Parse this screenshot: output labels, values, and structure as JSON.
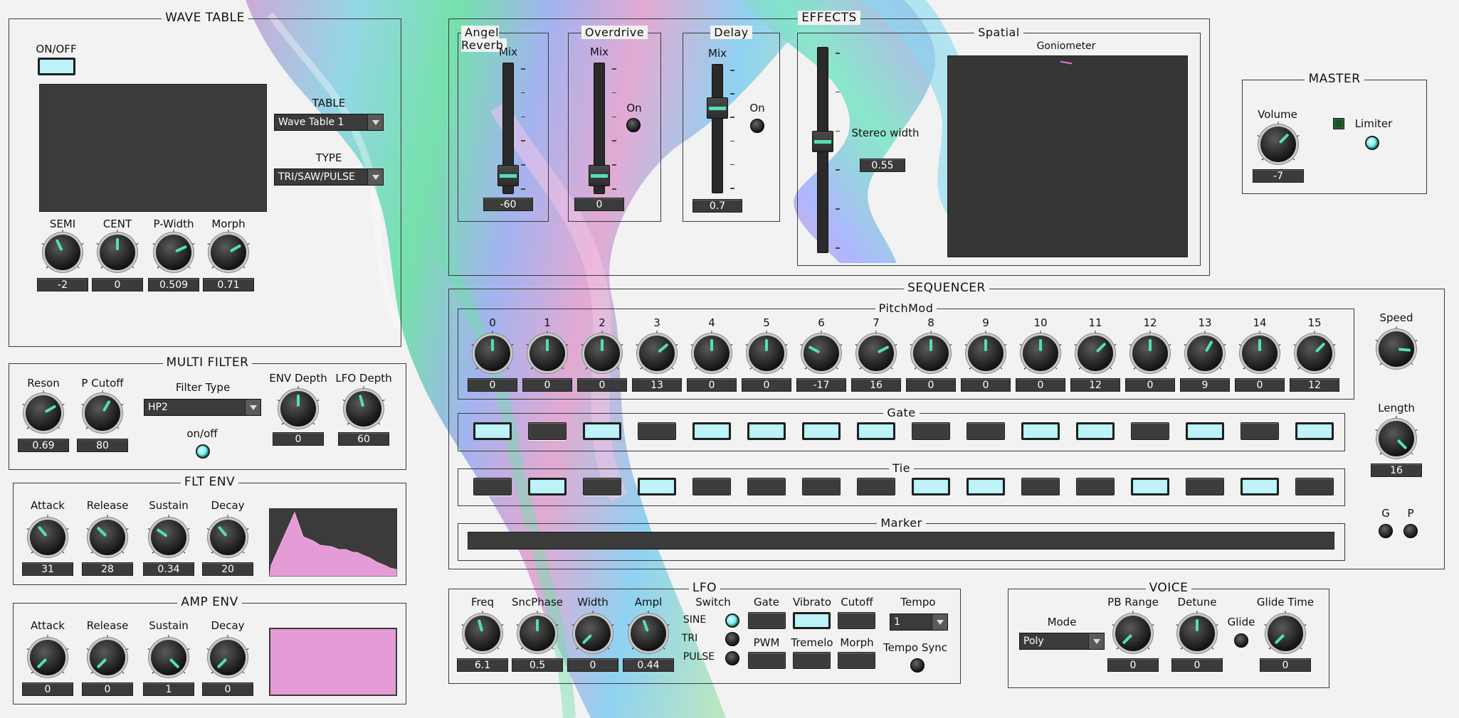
{
  "wavetable": {
    "title": "WAVE TABLE",
    "onoff_label": "ON/OFF",
    "table_label": "TABLE",
    "table_value": "Wave Table 1",
    "type_label": "TYPE",
    "type_value": "TRI/SAW/PULSE",
    "knobs": [
      {
        "label": "SEMI",
        "value": "-2",
        "angle": -25
      },
      {
        "label": "CENT",
        "value": "0",
        "angle": 0
      },
      {
        "label": "P-Width",
        "value": "0.509",
        "angle": 65
      },
      {
        "label": "Morph",
        "value": "0.71",
        "angle": 60
      }
    ]
  },
  "multifilter": {
    "title": "MULTI FILTER",
    "filter_type_label": "Filter Type",
    "filter_type_value": "HP2",
    "onoff_label": "on/off",
    "knobs": [
      {
        "label": "Reson",
        "value": "0.69",
        "angle": 60
      },
      {
        "label": "P Cutoff",
        "value": "80",
        "angle": 30
      },
      {
        "label": "ENV Depth",
        "value": "0",
        "angle": 0
      },
      {
        "label": "LFO Depth",
        "value": "60",
        "angle": -15
      }
    ]
  },
  "fltenv": {
    "title": "FLT ENV",
    "knobs": [
      {
        "label": "Attack",
        "value": "31",
        "angle": -40
      },
      {
        "label": "Release",
        "value": "28",
        "angle": -45
      },
      {
        "label": "Sustain",
        "value": "0.34",
        "angle": -55
      },
      {
        "label": "Decay",
        "value": "20",
        "angle": -40
      }
    ]
  },
  "ampenv": {
    "title": "AMP ENV",
    "knobs": [
      {
        "label": "Attack",
        "value": "0",
        "angle": -135
      },
      {
        "label": "Release",
        "value": "0",
        "angle": -135
      },
      {
        "label": "Sustain",
        "value": "1",
        "angle": 135
      },
      {
        "label": "Decay",
        "value": "0",
        "angle": -135
      }
    ]
  },
  "effects": {
    "title": "EFFECTS",
    "reverb": {
      "title": "Angel Reverb",
      "mix_label": "Mix",
      "value": "-60",
      "level": 0.08
    },
    "overdrive": {
      "title": "Overdrive",
      "mix_label": "Mix",
      "value": "0",
      "on_label": "On",
      "level": 0.08
    },
    "delay": {
      "title": "Delay",
      "mix_label": "Mix",
      "value": "0.7",
      "on_label": "On",
      "level": 0.7
    },
    "spatial": {
      "title": "Spatial",
      "stereo_label": "Stereo width",
      "stereo_value": "0.55",
      "goniometer_label": "Goniometer",
      "level": 0.55
    }
  },
  "master": {
    "title": "MASTER",
    "volume_label": "Volume",
    "volume_value": "-7",
    "volume_angle": 45,
    "limiter_label": "Limiter"
  },
  "sequencer": {
    "title": "SEQUENCER",
    "pitchmod_label": "PitchMod",
    "gate_label": "Gate",
    "tie_label": "Tie",
    "marker_label": "Marker",
    "speed_label": "Speed",
    "speed_angle": 95,
    "length_label": "Length",
    "length_value": "16",
    "length_angle": 135,
    "g_label": "G",
    "p_label": "P",
    "steps": [
      {
        "n": "0",
        "value": "0",
        "angle": 0,
        "gate": true,
        "tie": false
      },
      {
        "n": "1",
        "value": "0",
        "angle": 0,
        "gate": false,
        "tie": true
      },
      {
        "n": "2",
        "value": "0",
        "angle": 0,
        "gate": true,
        "tie": false
      },
      {
        "n": "3",
        "value": "13",
        "angle": 50,
        "gate": false,
        "tie": true
      },
      {
        "n": "4",
        "value": "0",
        "angle": 0,
        "gate": true,
        "tie": false
      },
      {
        "n": "5",
        "value": "0",
        "angle": 0,
        "gate": true,
        "tie": false
      },
      {
        "n": "6",
        "value": "-17",
        "angle": -62,
        "gate": true,
        "tie": false
      },
      {
        "n": "7",
        "value": "16",
        "angle": 62,
        "gate": true,
        "tie": false
      },
      {
        "n": "8",
        "value": "0",
        "angle": 0,
        "gate": false,
        "tie": true
      },
      {
        "n": "9",
        "value": "0",
        "angle": 0,
        "gate": false,
        "tie": true
      },
      {
        "n": "10",
        "value": "0",
        "angle": 0,
        "gate": true,
        "tie": false
      },
      {
        "n": "11",
        "value": "12",
        "angle": 45,
        "gate": true,
        "tie": false
      },
      {
        "n": "12",
        "value": "0",
        "angle": 0,
        "gate": false,
        "tie": true
      },
      {
        "n": "13",
        "value": "9",
        "angle": 30,
        "gate": true,
        "tie": false
      },
      {
        "n": "14",
        "value": "0",
        "angle": 0,
        "gate": false,
        "tie": true
      },
      {
        "n": "15",
        "value": "12",
        "angle": 45,
        "gate": true,
        "tie": false
      }
    ]
  },
  "lfo": {
    "title": "LFO",
    "switch_label": "Switch",
    "sine_label": "SINE",
    "tri_label": "TRI",
    "pulse_label": "PULSE",
    "gate_label": "Gate",
    "vibrato_label": "Vibrato",
    "cutoff_label": "Cutoff",
    "pwm_label": "PWM",
    "tremelo_label": "Tremelo",
    "morph_label": "Morph",
    "tempo_label": "Tempo",
    "tempo_value": "1",
    "tempo_sync_label": "Tempo Sync",
    "knobs": [
      {
        "label": "Freq",
        "value": "6.1",
        "angle": -15
      },
      {
        "label": "SncPhase",
        "value": "0.5",
        "angle": 0
      },
      {
        "label": "Width",
        "value": "0",
        "angle": -135
      },
      {
        "label": "Ampl",
        "value": "0.44",
        "angle": -20
      }
    ]
  },
  "voice": {
    "title": "VOICE",
    "mode_label": "Mode",
    "mode_value": "Poly",
    "glide_label": "Glide",
    "knobs": [
      {
        "label": "PB Range",
        "value": "0",
        "angle": -135
      },
      {
        "label": "Detune",
        "value": "0",
        "angle": 0
      },
      {
        "label": "Glide Time",
        "value": "0",
        "angle": -135
      }
    ]
  }
}
